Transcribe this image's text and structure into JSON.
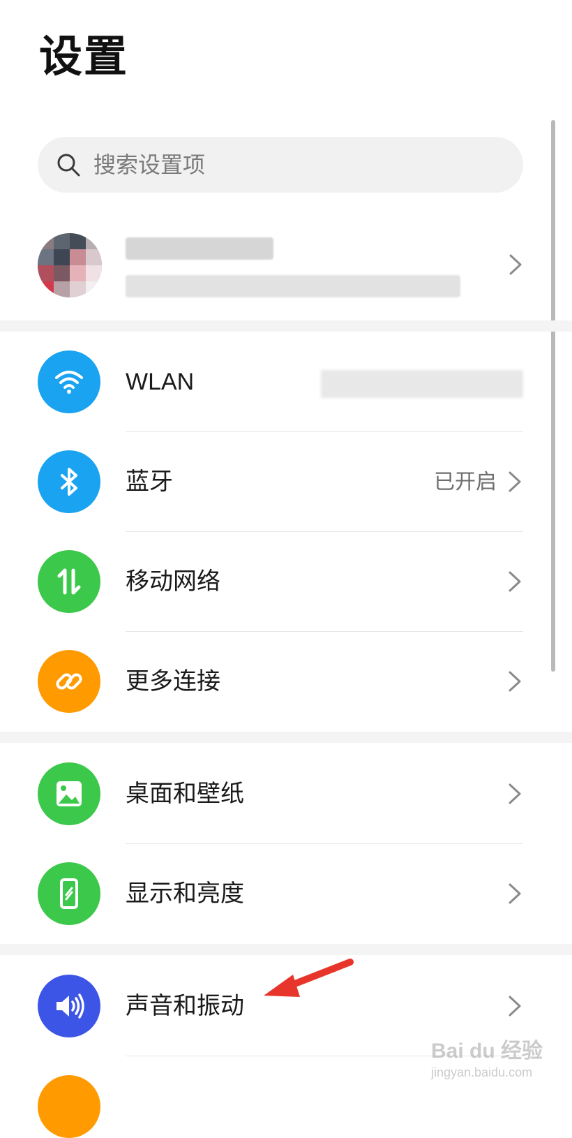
{
  "header": {
    "title": "设置"
  },
  "search": {
    "placeholder": "搜索设置项"
  },
  "profile": {
    "chevron": "chevron-right-icon"
  },
  "sections": [
    {
      "items": [
        {
          "label": "WLAN",
          "value": "",
          "icon": "wifi-icon",
          "icon_color": "#1aa3f0"
        },
        {
          "label": "蓝牙",
          "value": "已开启",
          "icon": "bluetooth-icon",
          "icon_color": "#1aa3f0"
        },
        {
          "label": "移动网络",
          "value": "",
          "icon": "mobile-network-icon",
          "icon_color": "#3cc84b"
        },
        {
          "label": "更多连接",
          "value": "",
          "icon": "link-icon",
          "icon_color": "#ff9a00"
        }
      ]
    },
    {
      "items": [
        {
          "label": "桌面和壁纸",
          "value": "",
          "icon": "wallpaper-icon",
          "icon_color": "#3cc84b"
        },
        {
          "label": "显示和亮度",
          "value": "",
          "icon": "display-icon",
          "icon_color": "#3cc84b"
        }
      ]
    },
    {
      "items": [
        {
          "label": "声音和振动",
          "value": "",
          "icon": "sound-icon",
          "icon_color": "#3d55e6"
        }
      ]
    }
  ],
  "watermark": {
    "brand": "Bai du 经验",
    "url": "jingyan.baidu.com"
  },
  "colors": {
    "background": "#ffffff",
    "section_gap": "#f4f4f4",
    "annotation_arrow": "#e8352b"
  }
}
